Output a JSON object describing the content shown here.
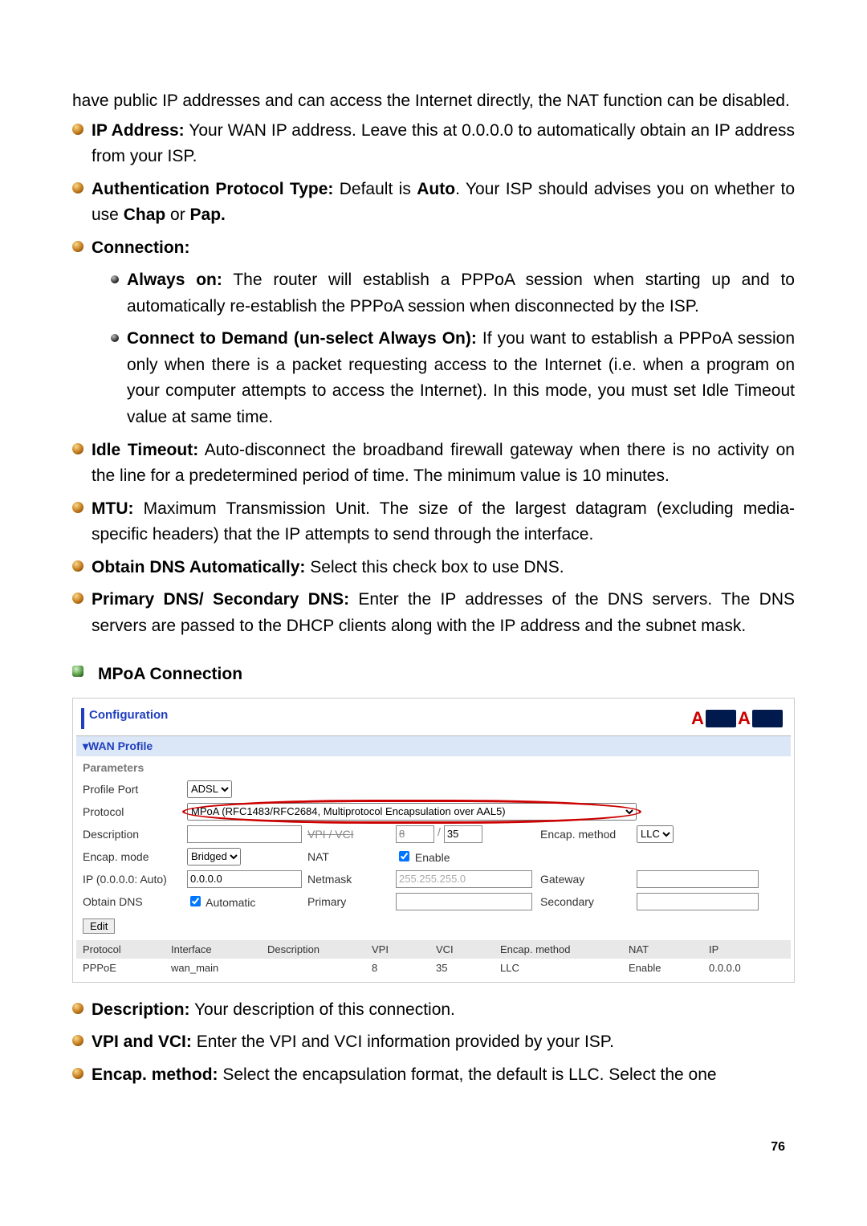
{
  "intro_text": "have public IP addresses and can access the Internet directly, the NAT function can be disabled.",
  "ip_addr_label": "IP Address:",
  "ip_addr_text": " Your WAN IP address. Leave this at 0.0.0.0 to automatically obtain an IP address from your ISP.",
  "auth_label": "Authentication Protocol Type:",
  "auth_text_1": " Default is ",
  "auth_bold": "Auto",
  "auth_text_2": ". Your ISP should advises you on whether to use ",
  "auth_chap": "Chap",
  "auth_or": " or ",
  "auth_pap": "Pap.",
  "conn_label": "Connection:",
  "always_on_label": "Always on:",
  "always_on_text": " The router will establish a PPPoA session when starting up and to automatically re-establish the PPPoA session when disconnected by the ISP.",
  "ctd_label": "Connect to Demand (un-select Always On):",
  "ctd_text": " If you want to establish a PPPoA session only when there is a packet requesting access to the Internet (i.e. when a program on your computer attempts to access the Internet). In this mode, you must set Idle Timeout value at same time.",
  "idle_label": "Idle Timeout:",
  "idle_text": " Auto-disconnect the broadband firewall gateway when there is no activity on the line for a predetermined period of time. The minimum value is 10 minutes.",
  "mtu_label": "MTU:",
  "mtu_text": " Maximum Transmission Unit. The size of the largest datagram (excluding media-specific headers) that the IP attempts to send through the interface.",
  "dns_auto_label": "Obtain DNS Automatically:",
  "dns_auto_text": " Select this check box to use DNS.",
  "dns_pri_label": "Primary DNS/ Secondary DNS:",
  "dns_pri_text": " Enter the IP addresses of the DNS servers. The DNS servers are passed to the DHCP clients along with the IP address and the subnet mask.",
  "mpoa_heading": "MPoA Connection",
  "config": {
    "title": "Configuration",
    "tab": "▾WAN Profile",
    "params_label": "Parameters",
    "profile_port_label": "Profile Port",
    "profile_port_value": "ADSL",
    "protocol_label": "Protocol",
    "protocol_value": "MPoA (RFC1483/RFC2684, Multiprotocol Encapsulation over AAL5)",
    "description_label": "Description",
    "description_value": "",
    "vpi_vci_label": "VPI / VCI",
    "vpi_value": "8",
    "vci_value": "35",
    "encap_method_label": "Encap. method",
    "encap_method_value": "LLC",
    "encap_mode_label": "Encap. mode",
    "encap_mode_value": "Bridged",
    "nat_label": "NAT",
    "nat_enable": "Enable",
    "ip_label": "IP (0.0.0.0: Auto)",
    "ip_value": "0.0.0.0",
    "netmask_label": "Netmask",
    "netmask_value": "255.255.255.0",
    "gateway_label": "Gateway",
    "gateway_value": "",
    "obtain_dns_label": "Obtain DNS",
    "obtain_dns_auto": "Automatic",
    "primary_label": "Primary",
    "primary_value": "",
    "secondary_label": "Secondary",
    "secondary_value": "",
    "edit_btn": "Edit",
    "table": {
      "headers": [
        "Protocol",
        "Interface",
        "Description",
        "VPI",
        "VCI",
        "Encap. method",
        "NAT",
        "IP"
      ],
      "row": [
        "PPPoE",
        "wan_main",
        "",
        "8",
        "35",
        "LLC",
        "Enable",
        "0.0.0.0"
      ]
    }
  },
  "desc_label": "Description:",
  "desc_text": " Your description of this connection.",
  "vpi_vci_label2": "VPI and VCI:",
  "vpi_vci_text": " Enter the VPI and VCI information provided by your ISP.",
  "encap_label2": "Encap. method:",
  "encap_text2": " Select the encapsulation format, the default is LLC. Select the one",
  "page_number": "76"
}
